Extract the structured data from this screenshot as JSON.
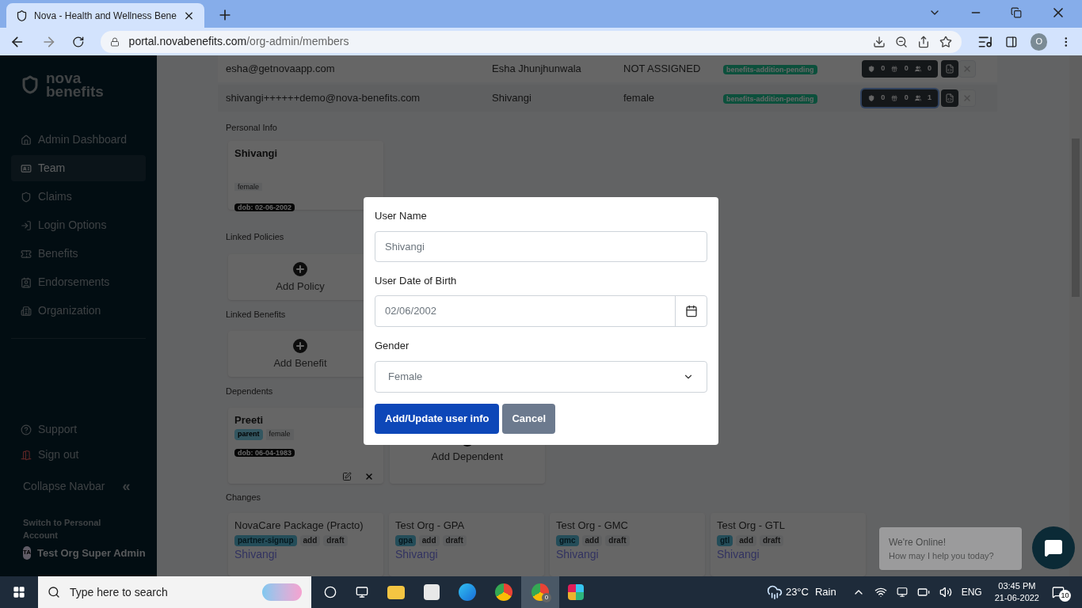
{
  "browser": {
    "tab_title": "Nova - Health and Wellness Bene",
    "url_host": "portal.novabenefits.com",
    "url_path": "/org-admin/members",
    "profile": "O"
  },
  "sidebar": {
    "logo": [
      "nova",
      "benefits"
    ],
    "items": [
      {
        "label": "Admin Dashboard",
        "selected": false
      },
      {
        "label": "Team",
        "selected": true
      },
      {
        "label": "Claims",
        "selected": false
      },
      {
        "label": "Login Options",
        "selected": false
      },
      {
        "label": "Benefits",
        "selected": false
      },
      {
        "label": "Endorsements",
        "selected": false
      },
      {
        "label": "Organization",
        "selected": false
      }
    ],
    "bottom_items": [
      {
        "label": "Support"
      },
      {
        "label": "Sign out"
      }
    ],
    "collapse": "Collapse Navbar",
    "collapse_icon": "«",
    "switch_label": "Switch to Personal Account",
    "user": {
      "initials": "TA",
      "name": "Test Org Super Admin"
    }
  },
  "members": [
    {
      "email": "esha@getnovaapp.com",
      "name": "Esha Jhunjhunwala",
      "gender": "NOT ASSIGNED",
      "status": "benefits-addition-pending",
      "counts": [
        "0",
        "0",
        "0"
      ],
      "selected": false
    },
    {
      "email": "shivangi++++++demo@nova-benefits.com",
      "name": "Shivangi",
      "gender": "female",
      "status": "benefits-addition-pending",
      "counts": [
        "0",
        "0",
        "1"
      ],
      "selected": true
    }
  ],
  "details": {
    "personal": {
      "heading": "Personal Info",
      "name": "Shivangi",
      "gender": "female",
      "dob": "dob: 02-06-2002"
    },
    "policies": {
      "heading": "Linked Policies",
      "add": "Add Policy"
    },
    "benefits": {
      "heading": "Linked Benefits",
      "add": "Add Benefit"
    },
    "dependents": {
      "heading": "Dependents",
      "items": [
        {
          "name": "Preeti",
          "relation": "parent",
          "gender": "female",
          "dob": "dob: 06-04-1983"
        }
      ],
      "add": "Add Dependent"
    },
    "changes": {
      "heading": "Changes",
      "items": [
        {
          "title": "NovaCare Package (Practo)",
          "tags": [
            {
              "text": "partner-signup",
              "kind": "type"
            },
            {
              "text": "add",
              "kind": "plain"
            },
            {
              "text": "draft",
              "kind": "plain"
            }
          ],
          "member": "Shivangi"
        },
        {
          "title": "Test Org - GPA",
          "tags": [
            {
              "text": "gpa",
              "kind": "type"
            },
            {
              "text": "add",
              "kind": "plain"
            },
            {
              "text": "draft",
              "kind": "plain"
            }
          ],
          "member": "Shivangi"
        },
        {
          "title": "Test Org - GMC",
          "tags": [
            {
              "text": "gmc",
              "kind": "type"
            },
            {
              "text": "add",
              "kind": "plain"
            },
            {
              "text": "draft",
              "kind": "plain"
            }
          ],
          "member": "Shivangi"
        },
        {
          "title": "Test Org - GTL",
          "tags": [
            {
              "text": "gtl",
              "kind": "type"
            },
            {
              "text": "add",
              "kind": "plain"
            },
            {
              "text": "draft",
              "kind": "plain"
            }
          ],
          "member": "Shivangi"
        }
      ]
    }
  },
  "modal": {
    "name_label": "User Name",
    "name_value": "Shivangi",
    "dob_label": "User Date of Birth",
    "dob_value": "02/06/2002",
    "gender_label": "Gender",
    "gender_value": "Female",
    "submit": "Add/Update user info",
    "cancel": "Cancel"
  },
  "chat": {
    "title": "We're Online!",
    "subtitle": "How may I help you today?"
  },
  "taskbar": {
    "search": "Type here to search",
    "chrome_badge": "0",
    "temperature": "23°C",
    "weather": "Rain",
    "language": "ENG",
    "time": "03:45 PM",
    "date": "21-06-2022",
    "notifications": "10"
  }
}
